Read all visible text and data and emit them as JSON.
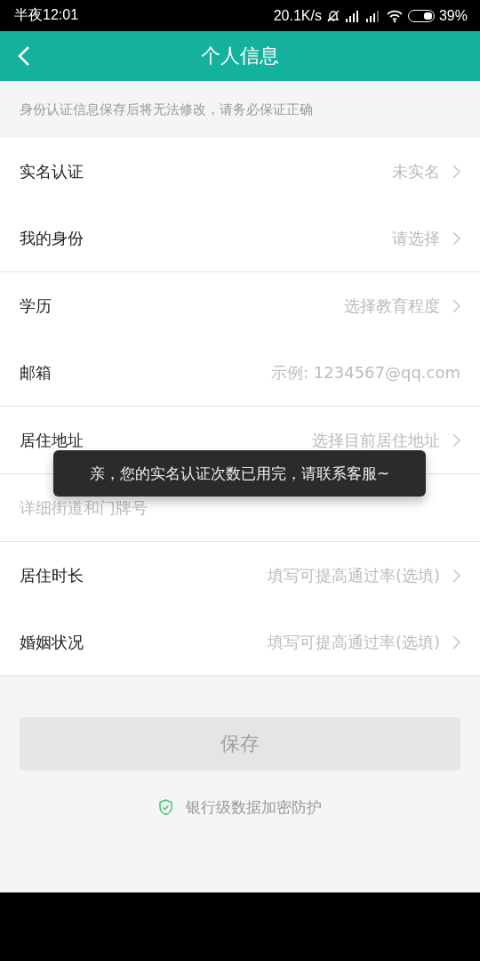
{
  "status_bar": {
    "time": "半夜12:01",
    "speed": "20.1K/s",
    "battery": "39%"
  },
  "header": {
    "title": "个人信息"
  },
  "notice": "身份认证信息保存后将无法修改，请务必保证正确",
  "groups": [
    {
      "rows": [
        {
          "kind": "select",
          "label": "实名认证",
          "value": "未实名"
        },
        {
          "kind": "select",
          "label": "我的身份",
          "value": "请选择"
        }
      ]
    },
    {
      "rows": [
        {
          "kind": "select",
          "label": "学历",
          "value": "选择教育程度"
        },
        {
          "kind": "input",
          "label": "邮箱",
          "placeholder": "示例: 1234567@qq.com"
        }
      ]
    },
    {
      "rows": [
        {
          "kind": "select",
          "label": "居住地址",
          "value": "选择目前居住地址"
        }
      ]
    },
    {
      "rows": [
        {
          "kind": "wide_input",
          "placeholder": "详细街道和门牌号"
        }
      ]
    },
    {
      "rows": [
        {
          "kind": "select",
          "label": "居住时长",
          "value": "填写可提高通过率(选填)"
        },
        {
          "kind": "select",
          "label": "婚姻状况",
          "value": "填写可提高通过率(选填)"
        }
      ]
    }
  ],
  "save_button": {
    "label": "保存",
    "disabled": true
  },
  "security_note": "银行级数据加密防护",
  "toast": "亲，您的实名认证次数已用完，请联系客服~"
}
